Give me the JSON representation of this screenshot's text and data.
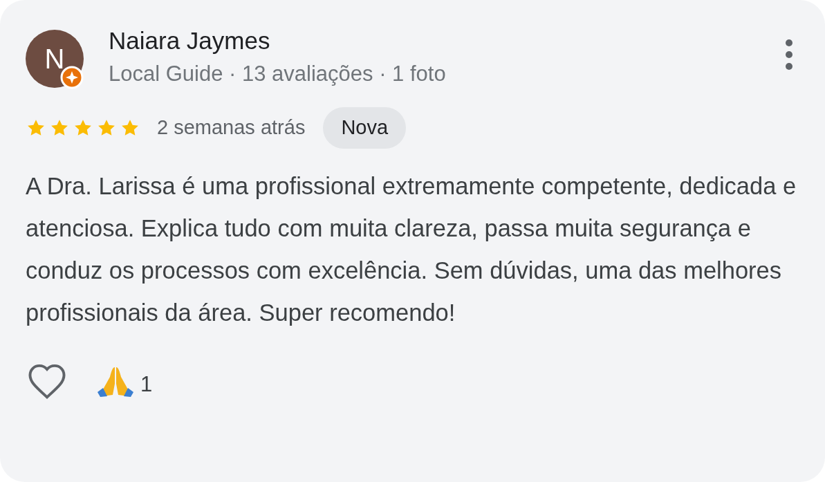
{
  "review": {
    "avatar_letter": "N",
    "local_guide_badge": true,
    "author": "Naiara Jaymes",
    "author_meta": "Local Guide · 13 avaliações · 1 foto",
    "stars": 5,
    "time": "2 semanas atrás",
    "tag": "Nova",
    "text": "A Dra. Larissa é uma profissional extremamente competente, dedicada e atenciosa. Explica tudo com muita clareza, passa muita segurança e conduz os processos com excelência. Sem dúvidas, uma das melhores profissionais da área. Super recomendo!",
    "liked": false,
    "reactions": [
      {
        "kind": "praying-hands",
        "count": "1"
      }
    ]
  }
}
